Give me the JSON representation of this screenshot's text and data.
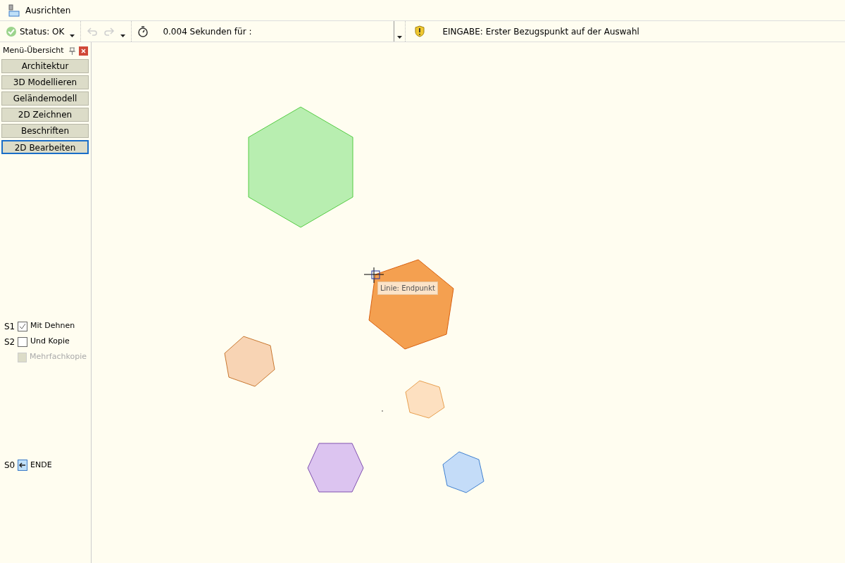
{
  "window": {
    "title": "Ausrichten"
  },
  "toolbar": {
    "status": "Status: OK",
    "timing": "0.004 Sekunden für :",
    "prompt": "EINGABE: Erster Bezugspunkt auf der Auswahl"
  },
  "menu_panel": {
    "title": "Menü-Übersicht",
    "items": [
      {
        "label": "Architektur",
        "selected": false
      },
      {
        "label": "3D Modellieren",
        "selected": false
      },
      {
        "label": "Geländemodell",
        "selected": false
      },
      {
        "label": "2D Zeichnen",
        "selected": false
      },
      {
        "label": "Beschriften",
        "selected": false
      },
      {
        "label": "2D Bearbeiten",
        "selected": true
      }
    ]
  },
  "options": [
    {
      "shortcut": "S1",
      "label": "Mit Dehnen",
      "checked": true,
      "disabled": false
    },
    {
      "shortcut": "S2",
      "label": "Und Kopie",
      "checked": false,
      "disabled": false
    },
    {
      "label": "Mehrfachkopie",
      "checked": false,
      "disabled": true
    }
  ],
  "end_option": {
    "shortcut": "S0",
    "label": "ENDE"
  },
  "canvas": {
    "snap_tooltip": "Linie: Endpunkt"
  }
}
